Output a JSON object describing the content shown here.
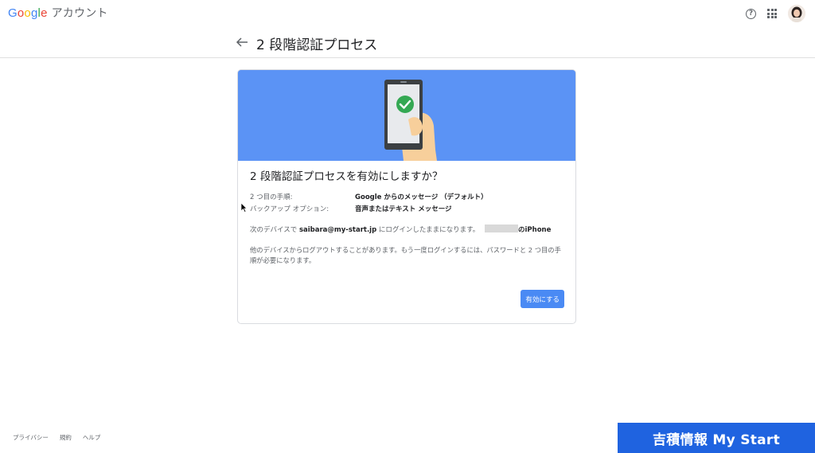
{
  "header": {
    "logo_letters": [
      "G",
      "o",
      "o",
      "g",
      "l",
      "e"
    ],
    "logo_suffix": "アカウント",
    "help_glyph": "?"
  },
  "title_bar": {
    "title": "2 段階認証プロセス"
  },
  "card": {
    "heading": "2 段階認証プロセスを有効にしますか？",
    "second_step_label": "2 つ目の手順:",
    "second_step_value": "Google からのメッセージ （デフォルト）",
    "backup_label": "バックアップ オプション:",
    "backup_value": "音声またはテキスト メッセージ",
    "device_prefix": "次のデバイスで",
    "device_email": "saibara@my-start.jp",
    "device_suffix": "にログインしたままになります。",
    "device_name": "のiPhone",
    "note": "他のデバイスからログアウトすることがあります。もう一度ログインするには、パスワードと 2 つ目の手順が必要になります。",
    "enable_button": "有効にする"
  },
  "footer": {
    "privacy": "プライバシー",
    "terms": "規約",
    "help": "ヘルプ"
  },
  "brand_overlay": "吉積情報 My Start",
  "colors": {
    "banner": "#5b93f5",
    "button": "#4a8af4",
    "brand_bar": "#1f63e0",
    "check": "#34a853"
  }
}
